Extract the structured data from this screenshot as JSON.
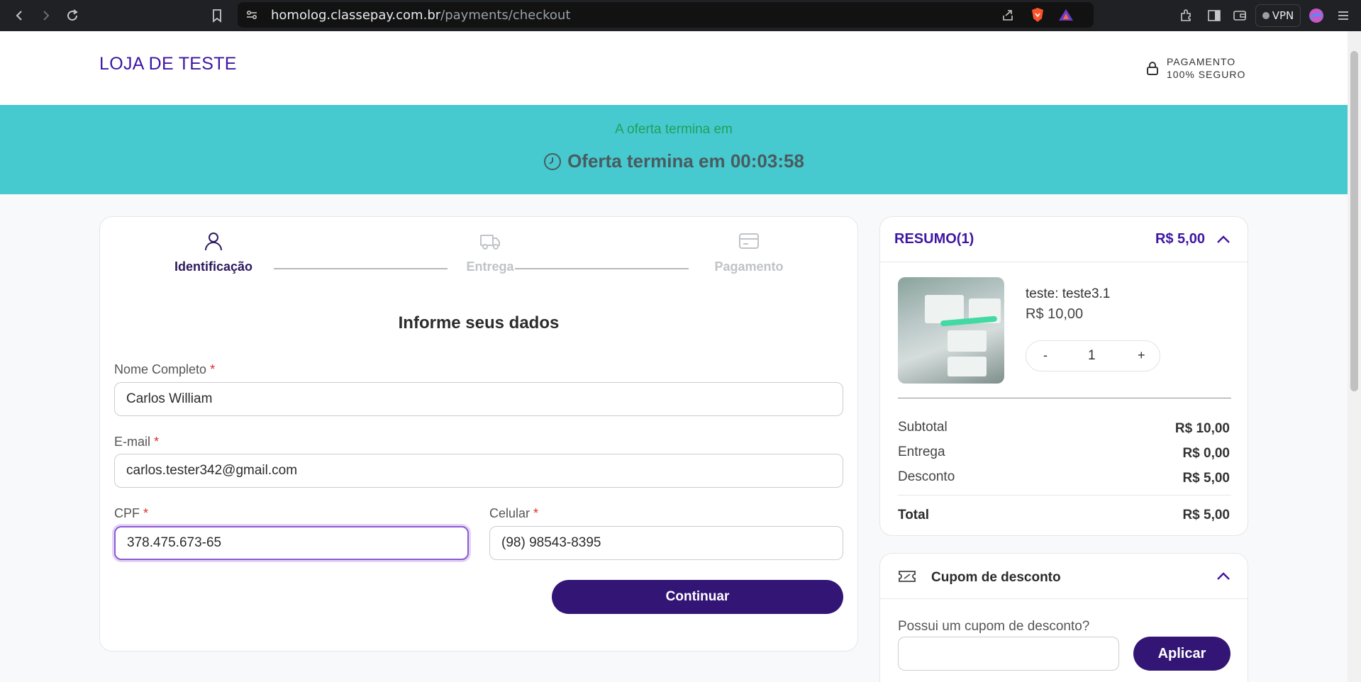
{
  "browser": {
    "url_domain": "homolog.classepay.com.br",
    "url_path": "/payments/checkout",
    "vpn_label": "VPN"
  },
  "header": {
    "store_name": "LOJA DE TESTE",
    "secure_line1": "PAGAMENTO",
    "secure_line2": "100% SEGURO",
    "accent_color": "#3e16a3"
  },
  "banner": {
    "subtitle": "A oferta termina em",
    "countdown": "Oferta termina em 00:03:58",
    "background": "#46c9cf"
  },
  "steps": [
    {
      "label": "Identificação",
      "icon": "user-icon",
      "active": true
    },
    {
      "label": "Entrega",
      "icon": "truck-icon",
      "active": false
    },
    {
      "label": "Pagamento",
      "icon": "credit-card-icon",
      "active": false
    }
  ],
  "form": {
    "title": "Informe seus dados",
    "required_mark": "*",
    "name_label": "Nome Completo",
    "name_value": "Carlos William",
    "email_label": "E-mail",
    "email_value": "carlos.tester342@gmail.com",
    "cpf_label": "CPF",
    "cpf_value": "378.475.673-65",
    "phone_label": "Celular",
    "phone_value": "(98) 98543-8395",
    "continue_label": "Continuar"
  },
  "summary": {
    "title": "RESUMO(1)",
    "total_head": "R$ 5,00",
    "product_name": "teste: teste3.1",
    "product_price": "R$ 10,00",
    "qty_minus": "-",
    "qty_value": "1",
    "qty_plus": "+",
    "subtotal_label": "Subtotal",
    "subtotal_value": "R$ 10,00",
    "shipping_label": "Entrega",
    "shipping_value": "R$ 0,00",
    "discount_label": "Desconto",
    "discount_value": "R$ 5,00",
    "total_label": "Total",
    "total_value": "R$ 5,00"
  },
  "coupon": {
    "title": "Cupom de desconto",
    "question": "Possui um cupom de desconto?",
    "input_value": "",
    "apply_label": "Aplicar"
  }
}
